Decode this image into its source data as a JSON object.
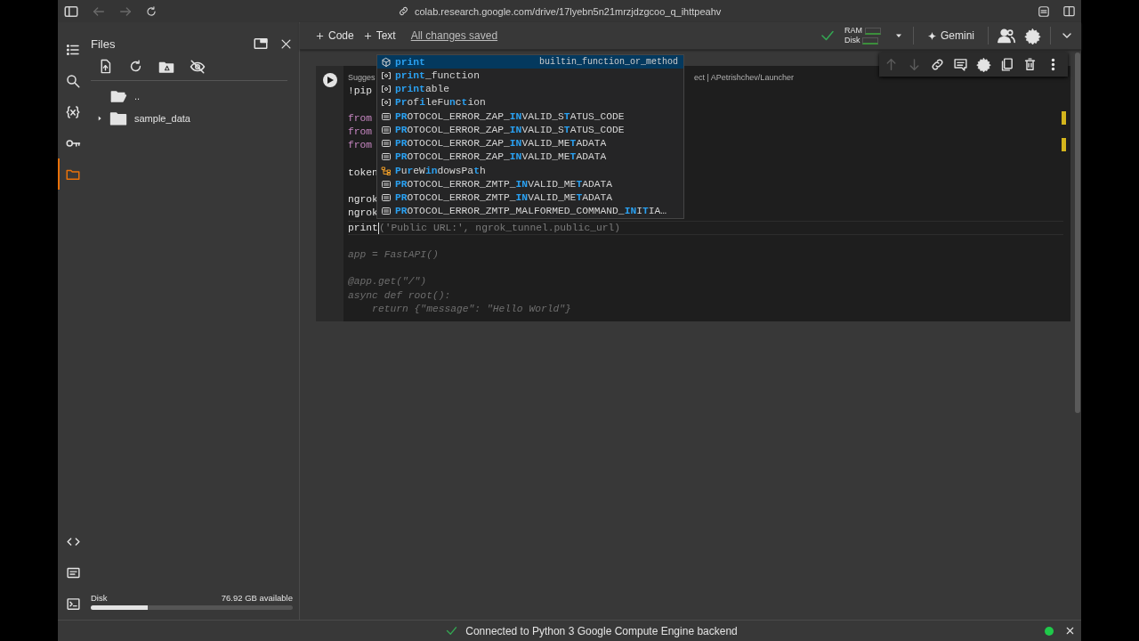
{
  "browser": {
    "url": "colab.research.google.com/drive/17lyebn5n21mrzjdzgcoo_q_ihttpeahv",
    "back": {
      "disabled": true
    },
    "forward": {
      "disabled": true
    }
  },
  "sidebar": {
    "title": "Files",
    "rail": [
      {
        "kind": "search",
        "selected": false
      },
      {
        "kind": "variables",
        "selected": false
      },
      {
        "kind": "secrets",
        "selected": false
      },
      {
        "kind": "files",
        "selected": true
      }
    ],
    "rail_bottom": [
      {
        "kind": "code"
      },
      {
        "kind": "commands"
      },
      {
        "kind": "terminal"
      }
    ],
    "tree": [
      {
        "name": "..",
        "kind": "parent"
      },
      {
        "name": "sample_data",
        "kind": "folder",
        "expanded": false
      }
    ],
    "disk": {
      "label": "Disk",
      "available": "76.92 GB available",
      "level": 0.28
    }
  },
  "toolbar": {
    "add_code": "Code",
    "add_text": "Text",
    "save_status": "All changes saved",
    "ram": "RAM",
    "disk": "Disk",
    "gemini": "Gemini"
  },
  "cell": {
    "suggestion": {
      "left": "Sugges",
      "right": "ect | APetrishchev/Launcher"
    },
    "lines": [
      {
        "kind": "plain",
        "text": "!pip"
      },
      {
        "kind": "blank"
      },
      {
        "kind": "keyword",
        "text": "from"
      },
      {
        "kind": "keyword",
        "text": "from"
      },
      {
        "kind": "keyword",
        "text": "from"
      },
      {
        "kind": "blank"
      },
      {
        "kind": "plain",
        "text": "token"
      },
      {
        "kind": "blank"
      },
      {
        "kind": "plain",
        "text": "ngrok"
      },
      {
        "kind": "plain",
        "text": "ngrok"
      },
      {
        "kind": "current",
        "text": "print",
        "ghost": "('Public URL:', ngrok_tunnel.public_url)"
      },
      {
        "kind": "blank"
      },
      {
        "kind": "faded",
        "text": "app = FastAPI()"
      },
      {
        "kind": "blank"
      },
      {
        "kind": "faded",
        "text": "@app.get(\"/\")"
      },
      {
        "kind": "faded",
        "text": "async def root():"
      },
      {
        "kind": "faded",
        "text": "    return {\"message\": \"Hello World\"}"
      }
    ],
    "cell_toolbar": [
      {
        "kind": "up",
        "disabled": true
      },
      {
        "kind": "down",
        "disabled": true
      },
      {
        "kind": "link",
        "disabled": false
      },
      {
        "kind": "comment",
        "disabled": false
      },
      {
        "kind": "settings",
        "disabled": false
      },
      {
        "kind": "mirror",
        "disabled": false
      },
      {
        "kind": "delete",
        "disabled": false
      },
      {
        "kind": "more",
        "disabled": false
      }
    ],
    "autocomplete": [
      {
        "kind": "function",
        "selected": true,
        "detail": "builtin_function_or_method",
        "segments": [
          {
            "text": "print",
            "match": true
          }
        ]
      },
      {
        "kind": "variable",
        "selected": false,
        "segments": [
          {
            "text": "print",
            "match": true
          },
          {
            "text": "_function",
            "match": false
          }
        ]
      },
      {
        "kind": "variable",
        "selected": false,
        "segments": [
          {
            "text": "print",
            "match": true
          },
          {
            "text": "able",
            "match": false
          }
        ]
      },
      {
        "kind": "variable",
        "selected": false,
        "segments": [
          {
            "text": "Pr",
            "match": true
          },
          {
            "text": "of",
            "match": false
          },
          {
            "text": "i",
            "match": true
          },
          {
            "text": "leFu",
            "match": false
          },
          {
            "text": "n",
            "match": true
          },
          {
            "text": "c",
            "match": false
          },
          {
            "text": "t",
            "match": true
          },
          {
            "text": "ion",
            "match": false
          }
        ]
      },
      {
        "kind": "constant",
        "selected": false,
        "segments": [
          {
            "text": "PR",
            "match": true
          },
          {
            "text": "OTOCOL_ERROR_ZAP_",
            "match": false
          },
          {
            "text": "IN",
            "match": true
          },
          {
            "text": "VALID_S",
            "match": false
          },
          {
            "text": "T",
            "match": true
          },
          {
            "text": "ATUS_CODE",
            "match": false
          }
        ]
      },
      {
        "kind": "constant",
        "selected": false,
        "segments": [
          {
            "text": "PR",
            "match": true
          },
          {
            "text": "OTOCOL_ERROR_ZAP_",
            "match": false
          },
          {
            "text": "IN",
            "match": true
          },
          {
            "text": "VALID_S",
            "match": false
          },
          {
            "text": "T",
            "match": true
          },
          {
            "text": "ATUS_CODE",
            "match": false
          }
        ]
      },
      {
        "kind": "constant",
        "selected": false,
        "segments": [
          {
            "text": "PR",
            "match": true
          },
          {
            "text": "OTOCOL_ERROR_ZAP_",
            "match": false
          },
          {
            "text": "IN",
            "match": true
          },
          {
            "text": "VALID_ME",
            "match": false
          },
          {
            "text": "T",
            "match": true
          },
          {
            "text": "ADATA",
            "match": false
          }
        ]
      },
      {
        "kind": "constant",
        "selected": false,
        "segments": [
          {
            "text": "PR",
            "match": true
          },
          {
            "text": "OTOCOL_ERROR_ZAP_",
            "match": false
          },
          {
            "text": "IN",
            "match": true
          },
          {
            "text": "VALID_ME",
            "match": false
          },
          {
            "text": "T",
            "match": true
          },
          {
            "text": "ADATA",
            "match": false
          }
        ]
      },
      {
        "kind": "class",
        "selected": false,
        "segments": [
          {
            "text": "P",
            "match": true
          },
          {
            "text": "u",
            "match": false
          },
          {
            "text": "r",
            "match": true
          },
          {
            "text": "eW",
            "match": false
          },
          {
            "text": "in",
            "match": true
          },
          {
            "text": "dowsPa",
            "match": false
          },
          {
            "text": "t",
            "match": true
          },
          {
            "text": "h",
            "match": false
          }
        ]
      },
      {
        "kind": "constant",
        "selected": false,
        "segments": [
          {
            "text": "PR",
            "match": true
          },
          {
            "text": "OTOCOL_ERROR_ZMTP_",
            "match": false
          },
          {
            "text": "IN",
            "match": true
          },
          {
            "text": "VALID_ME",
            "match": false
          },
          {
            "text": "T",
            "match": true
          },
          {
            "text": "ADATA",
            "match": false
          }
        ]
      },
      {
        "kind": "constant",
        "selected": false,
        "segments": [
          {
            "text": "PR",
            "match": true
          },
          {
            "text": "OTOCOL_ERROR_ZMTP_",
            "match": false
          },
          {
            "text": "IN",
            "match": true
          },
          {
            "text": "VALID_ME",
            "match": false
          },
          {
            "text": "T",
            "match": true
          },
          {
            "text": "ADATA",
            "match": false
          }
        ]
      },
      {
        "kind": "constant",
        "selected": false,
        "segments": [
          {
            "text": "PR",
            "match": true
          },
          {
            "text": "OTOCOL_ERROR_ZMTP_MALFORMED_COMMAND_",
            "match": false
          },
          {
            "text": "IN",
            "match": true
          },
          {
            "text": "I",
            "match": false
          },
          {
            "text": "T",
            "match": true
          },
          {
            "text": "IA…",
            "match": false
          }
        ]
      }
    ]
  },
  "status_bar": {
    "text": "Connected to Python 3 Google Compute Engine backend",
    "connected": true
  }
}
